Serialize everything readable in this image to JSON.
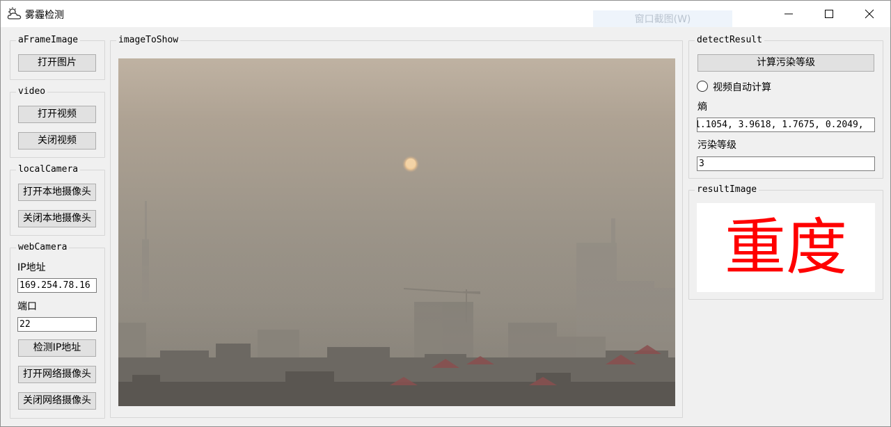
{
  "window": {
    "title": "雾霾检测",
    "overlay_tip": "窗口截图(W)",
    "controls": {
      "minimize": "minimize-icon",
      "maximize": "maximize-icon",
      "close": "close-icon"
    }
  },
  "groups": {
    "a_frame_image": {
      "title": "aFrameImage",
      "open_image": "打开图片"
    },
    "video": {
      "title": "video",
      "open_video": "打开视频",
      "close_video": "关闭视频"
    },
    "local_camera": {
      "title": "localCamera",
      "open_local": "打开本地摄像头",
      "close_local": "关闭本地摄像头"
    },
    "web_camera": {
      "title": "webCamera",
      "ip_label": "IP地址",
      "ip_value": "169.254.78.16",
      "port_label": "端口",
      "port_value": "22",
      "check_ip": "检测IP地址",
      "open_web": "打开网络摄像头",
      "close_web": "关闭网络摄像头"
    },
    "image_to_show": {
      "title": "imageToShow"
    },
    "detect_result": {
      "title": "detectResult",
      "compute_button": "计算污染等级",
      "auto_compute_label": "视频自动计算",
      "auto_compute_checked": false,
      "entropy_label": "熵",
      "entropy_value": "1.1054, 3.9618, 1.7675, 0.2049,",
      "level_label": "污染等级",
      "level_value": "3"
    },
    "result_image": {
      "title": "resultImage",
      "text": "重度",
      "text_color": "#ff0000"
    }
  }
}
